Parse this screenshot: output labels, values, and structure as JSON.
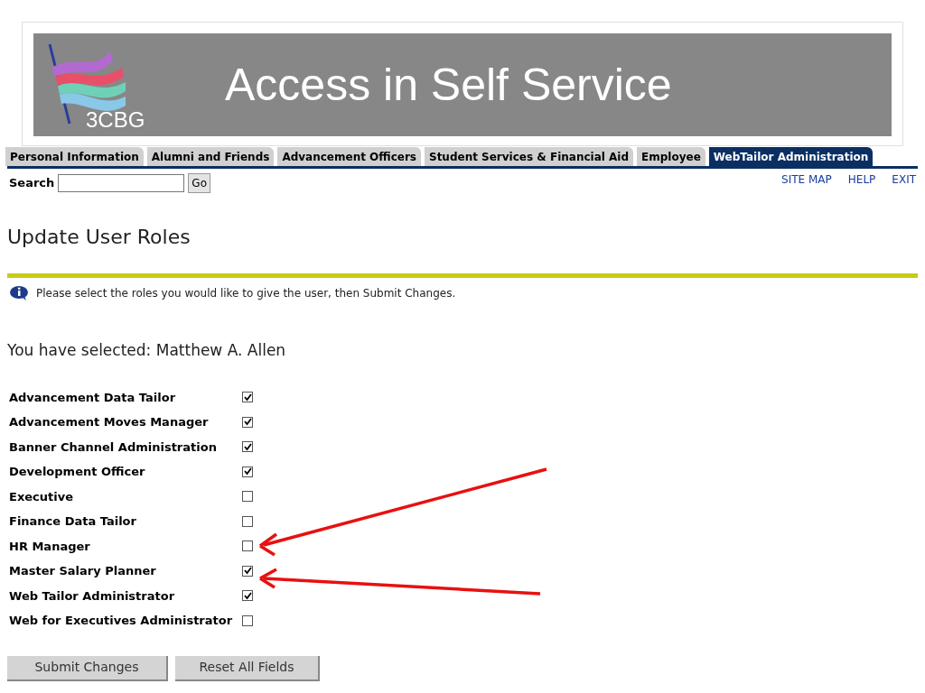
{
  "slide": {
    "title": "Access in Self Service",
    "logo_text": "3CBG"
  },
  "tabs": [
    {
      "label": "Personal Information",
      "selected": false
    },
    {
      "label": "Alumni and Friends",
      "selected": false
    },
    {
      "label": "Advancement Officers",
      "selected": false
    },
    {
      "label": "Student Services & Financial Aid",
      "selected": false
    },
    {
      "label": "Employee",
      "selected": false
    },
    {
      "label": "WebTailor Administration",
      "selected": true
    }
  ],
  "search": {
    "label": "Search",
    "button": "Go"
  },
  "links": [
    "SITE MAP",
    "HELP",
    "EXIT"
  ],
  "page_title": "Update User Roles",
  "info": "Please select the roles you would like to give the user, then Submit Changes.",
  "selected_user": "You have selected: Matthew A. Allen",
  "roles": [
    {
      "name": "Advancement Data Tailor",
      "checked": true
    },
    {
      "name": "Advancement Moves Manager",
      "checked": true
    },
    {
      "name": "Banner Channel Administration",
      "checked": true
    },
    {
      "name": "Development Officer",
      "checked": true
    },
    {
      "name": "Executive",
      "checked": false
    },
    {
      "name": "Finance Data Tailor",
      "checked": false
    },
    {
      "name": "HR Manager",
      "checked": false
    },
    {
      "name": "Master Salary Planner",
      "checked": true
    },
    {
      "name": "Web Tailor Administrator",
      "checked": true
    },
    {
      "name": "Web for Executives Administrator",
      "checked": false
    }
  ],
  "buttons": [
    "Submit Changes",
    "Reset All Fields"
  ]
}
